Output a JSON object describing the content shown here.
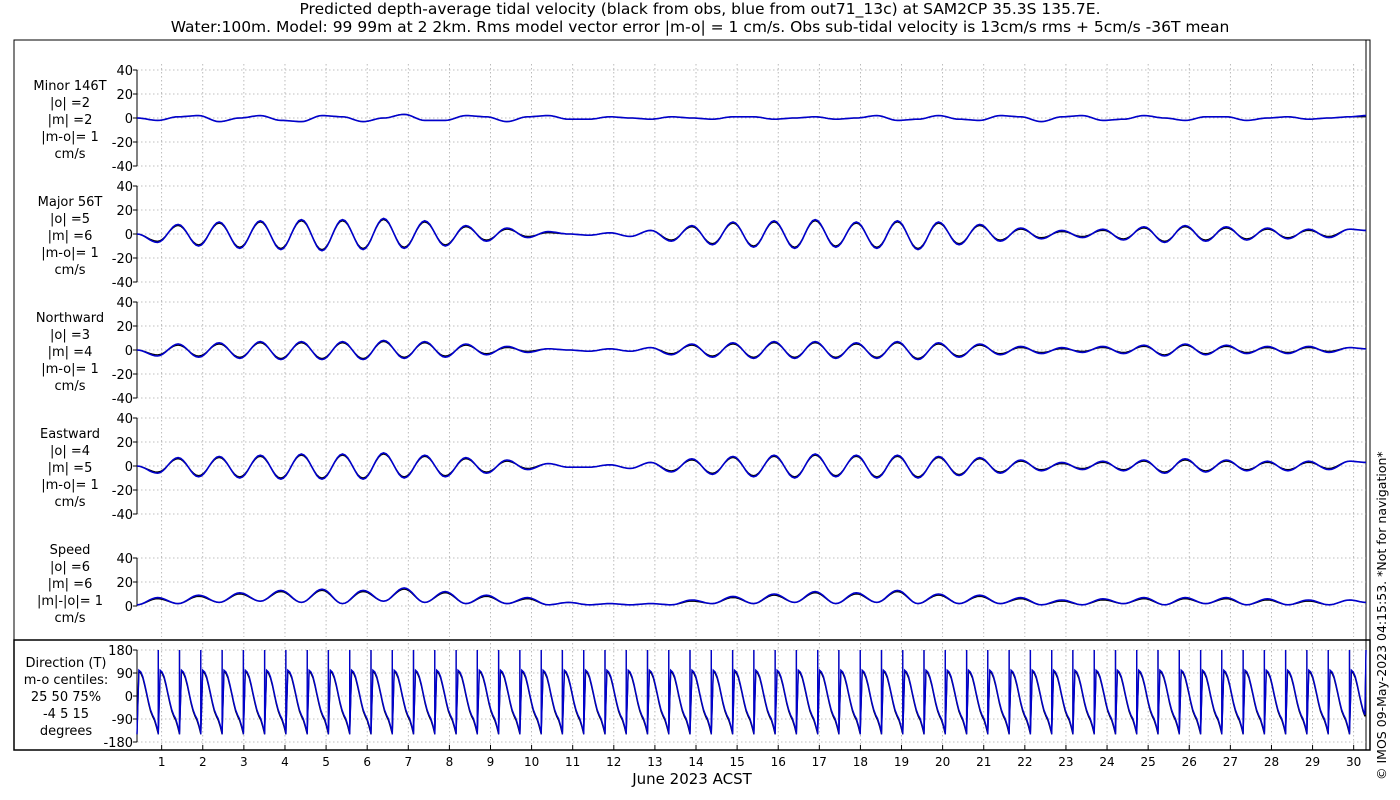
{
  "title_line1": "Predicted depth-average tidal velocity (black from obs, blue from out71_13c) at SAM2CP 35.3S 135.7E.",
  "title_line2": "Water:100m. Model: 99 99m at 2 2km. Rms model vector error |m-o| = 1 cm/s. Obs sub-tidal velocity is 13cm/s rms + 5cm/s -36T mean",
  "copyright": "© IMOS 09-May-2023 04:15:53.  *Not for navigation*",
  "colors": {
    "obs": "#000000",
    "model": "#0000cc",
    "grid": "#aaaaaa"
  },
  "chart_data": {
    "type": "line",
    "xlabel": "June 2023 ACST",
    "xlim": [
      0.4,
      30.3
    ],
    "x_ticks": [
      1,
      2,
      3,
      4,
      5,
      6,
      7,
      8,
      9,
      10,
      11,
      12,
      13,
      14,
      15,
      16,
      17,
      18,
      19,
      20,
      21,
      22,
      23,
      24,
      25,
      26,
      27,
      28,
      29,
      30
    ],
    "series_legend": [
      {
        "name": "obs",
        "color": "#000000"
      },
      {
        "name": "out71_13c",
        "color": "#0000cc"
      }
    ],
    "panels": [
      {
        "key": "minor",
        "label_lines": [
          "Minor 146T",
          "|o| =2",
          "|m| =2",
          "|m-o|= 1",
          "cm/s"
        ],
        "ylim": [
          -40,
          40
        ],
        "yticks": [
          "40",
          "20",
          "0",
          "-20",
          "-40"
        ],
        "x": [
          0.4,
          0.9,
          1.4,
          1.9,
          2.4,
          2.9,
          3.4,
          3.9,
          4.4,
          4.9,
          5.4,
          5.9,
          6.4,
          6.9,
          7.4,
          7.9,
          8.4,
          8.9,
          9.4,
          9.9,
          10.4,
          10.9,
          11.4,
          11.9,
          12.4,
          12.9,
          13.4,
          13.9,
          14.4,
          14.9,
          15.4,
          15.9,
          16.4,
          16.9,
          17.4,
          17.9,
          18.4,
          18.9,
          19.4,
          19.9,
          20.4,
          20.9,
          21.4,
          21.9,
          22.4,
          22.9,
          23.4,
          23.9,
          24.4,
          24.9,
          25.4,
          25.9,
          26.4,
          26.9,
          27.4,
          27.9,
          28.4,
          28.9,
          29.4,
          29.9,
          30.3
        ],
        "obs": [
          0,
          -2,
          1,
          2,
          -3,
          0,
          2,
          -2,
          -3,
          2,
          1,
          -3,
          0,
          3,
          -2,
          -2,
          2,
          1,
          -3,
          1,
          2,
          -1,
          -1,
          1,
          0,
          -1,
          1,
          0,
          -1,
          1,
          1,
          -1,
          0,
          1,
          -1,
          0,
          2,
          -2,
          -1,
          2,
          -1,
          -2,
          2,
          1,
          -3,
          1,
          2,
          -2,
          -1,
          2,
          0,
          -2,
          1,
          1,
          -2,
          0,
          1,
          -1,
          0,
          1,
          1
        ],
        "model": [
          0,
          -2,
          1,
          2,
          -3,
          0,
          2,
          -2,
          -3,
          2,
          1,
          -3,
          0,
          3,
          -2,
          -2,
          2,
          1,
          -3,
          1,
          2,
          -1,
          -1,
          1,
          0,
          -1,
          1,
          0,
          -1,
          1,
          1,
          -1,
          0,
          1,
          -1,
          0,
          2,
          -2,
          -1,
          2,
          -1,
          -2,
          2,
          1,
          -3,
          1,
          2,
          -2,
          -1,
          2,
          0,
          -2,
          1,
          1,
          -2,
          0,
          1,
          -1,
          0,
          1,
          2
        ]
      },
      {
        "key": "major",
        "label_lines": [
          "Major 56T",
          "|o| =5",
          "|m| =6",
          "|m-o|= 1",
          "cm/s"
        ],
        "ylim": [
          -40,
          40
        ],
        "yticks": [
          "40",
          "20",
          "0",
          "-20",
          "-40"
        ],
        "x": [
          0.4,
          0.9,
          1.4,
          1.9,
          2.4,
          2.9,
          3.4,
          3.9,
          4.4,
          4.9,
          5.4,
          5.9,
          6.4,
          6.9,
          7.4,
          7.9,
          8.4,
          8.9,
          9.4,
          9.9,
          10.4,
          10.9,
          11.4,
          11.9,
          12.4,
          12.9,
          13.4,
          13.9,
          14.4,
          14.9,
          15.4,
          15.9,
          16.4,
          16.9,
          17.4,
          17.9,
          18.4,
          18.9,
          19.4,
          19.9,
          20.4,
          20.9,
          21.4,
          21.9,
          22.4,
          22.9,
          23.4,
          23.9,
          24.4,
          24.9,
          25.4,
          25.9,
          26.4,
          26.9,
          27.4,
          27.9,
          28.4,
          28.9,
          29.4,
          29.9,
          30.3
        ],
        "obs": [
          0,
          -6,
          7,
          -9,
          9,
          -11,
          10,
          -12,
          11,
          -13,
          11,
          -12,
          12,
          -11,
          10,
          -9,
          6,
          -5,
          4,
          -2,
          1,
          0,
          -1,
          1,
          -2,
          3,
          -5,
          6,
          -8,
          9,
          -10,
          10,
          -11,
          11,
          -10,
          9,
          -11,
          10,
          -12,
          9,
          -8,
          7,
          -5,
          4,
          -3,
          2,
          -2,
          3,
          -4,
          5,
          -6,
          6,
          -5,
          5,
          -4,
          4,
          -3,
          3,
          -2,
          4,
          3
        ],
        "model": [
          0,
          -7,
          8,
          -10,
          10,
          -12,
          11,
          -13,
          12,
          -14,
          12,
          -13,
          13,
          -12,
          11,
          -10,
          7,
          -6,
          5,
          -3,
          2,
          0,
          -1,
          1,
          -2,
          3,
          -6,
          7,
          -9,
          10,
          -11,
          11,
          -12,
          12,
          -11,
          10,
          -12,
          11,
          -13,
          10,
          -9,
          8,
          -6,
          5,
          -4,
          3,
          -3,
          4,
          -5,
          6,
          -7,
          7,
          -6,
          6,
          -5,
          5,
          -4,
          4,
          -3,
          4,
          3
        ]
      },
      {
        "key": "north",
        "label_lines": [
          "Northward",
          "|o| =3",
          "|m| =4",
          "|m-o|= 1",
          "cm/s"
        ],
        "ylim": [
          -40,
          40
        ],
        "yticks": [
          "40",
          "20",
          "0",
          "-20",
          "-40"
        ],
        "x": [
          0.4,
          0.9,
          1.4,
          1.9,
          2.4,
          2.9,
          3.4,
          3.9,
          4.4,
          4.9,
          5.4,
          5.9,
          6.4,
          6.9,
          7.4,
          7.9,
          8.4,
          8.9,
          9.4,
          9.9,
          10.4,
          10.9,
          11.4,
          11.9,
          12.4,
          12.9,
          13.4,
          13.9,
          14.4,
          14.9,
          15.4,
          15.9,
          16.4,
          16.9,
          17.4,
          17.9,
          18.4,
          18.9,
          19.4,
          19.9,
          20.4,
          20.9,
          21.4,
          21.9,
          22.4,
          22.9,
          23.4,
          23.9,
          24.4,
          24.9,
          25.4,
          25.9,
          26.4,
          26.9,
          27.4,
          27.9,
          28.4,
          28.9,
          29.4,
          29.9,
          30.3
        ],
        "obs": [
          0,
          -4,
          4,
          -5,
          5,
          -6,
          6,
          -7,
          6,
          -7,
          6,
          -7,
          7,
          -6,
          6,
          -5,
          4,
          -3,
          2,
          -1,
          1,
          0,
          -1,
          1,
          -1,
          2,
          -3,
          4,
          -5,
          5,
          -6,
          6,
          -6,
          6,
          -6,
          5,
          -6,
          6,
          -7,
          5,
          -5,
          4,
          -3,
          2,
          -2,
          1,
          -1,
          2,
          -2,
          3,
          -4,
          4,
          -3,
          3,
          -2,
          2,
          -2,
          2,
          -1,
          2,
          1
        ],
        "model": [
          0,
          -5,
          5,
          -6,
          6,
          -7,
          7,
          -8,
          7,
          -8,
          7,
          -8,
          8,
          -7,
          7,
          -6,
          5,
          -4,
          3,
          -2,
          1,
          0,
          -1,
          1,
          -1,
          2,
          -4,
          5,
          -6,
          6,
          -7,
          7,
          -7,
          7,
          -7,
          6,
          -7,
          7,
          -8,
          6,
          -6,
          5,
          -4,
          3,
          -3,
          2,
          -2,
          3,
          -3,
          4,
          -5,
          5,
          -4,
          4,
          -3,
          3,
          -3,
          3,
          -2,
          2,
          1
        ]
      },
      {
        "key": "east",
        "label_lines": [
          "Eastward",
          "|o| =4",
          "|m| =5",
          "|m-o|= 1",
          "cm/s"
        ],
        "ylim": [
          -40,
          40
        ],
        "yticks": [
          "40",
          "20",
          "0",
          "-20",
          "-40"
        ],
        "x": [
          0.4,
          0.9,
          1.4,
          1.9,
          2.4,
          2.9,
          3.4,
          3.9,
          4.4,
          4.9,
          5.4,
          5.9,
          6.4,
          6.9,
          7.4,
          7.9,
          8.4,
          8.9,
          9.4,
          9.9,
          10.4,
          10.9,
          11.4,
          11.9,
          12.4,
          12.9,
          13.4,
          13.9,
          14.4,
          14.9,
          15.4,
          15.9,
          16.4,
          16.9,
          17.4,
          17.9,
          18.4,
          18.9,
          19.4,
          19.9,
          20.4,
          20.9,
          21.4,
          21.9,
          22.4,
          22.9,
          23.4,
          23.9,
          24.4,
          24.9,
          25.4,
          25.9,
          26.4,
          26.9,
          27.4,
          27.9,
          28.4,
          28.9,
          29.4,
          29.9,
          30.3
        ],
        "obs": [
          0,
          -5,
          6,
          -8,
          7,
          -9,
          8,
          -10,
          9,
          -10,
          9,
          -10,
          10,
          -9,
          8,
          -8,
          6,
          -5,
          4,
          -2,
          2,
          -1,
          -1,
          1,
          -2,
          3,
          -4,
          5,
          -6,
          7,
          -8,
          8,
          -9,
          9,
          -8,
          8,
          -9,
          8,
          -9,
          7,
          -7,
          6,
          -5,
          4,
          -3,
          2,
          -2,
          3,
          -3,
          4,
          -5,
          5,
          -4,
          4,
          -3,
          3,
          -3,
          3,
          -2,
          4,
          3
        ],
        "model": [
          0,
          -6,
          7,
          -9,
          8,
          -10,
          9,
          -11,
          10,
          -11,
          10,
          -11,
          11,
          -10,
          9,
          -9,
          7,
          -6,
          5,
          -3,
          2,
          -1,
          -1,
          1,
          -2,
          3,
          -5,
          6,
          -7,
          8,
          -9,
          9,
          -10,
          10,
          -9,
          9,
          -10,
          9,
          -10,
          8,
          -8,
          7,
          -6,
          5,
          -4,
          3,
          -3,
          4,
          -4,
          5,
          -6,
          6,
          -5,
          5,
          -4,
          4,
          -4,
          4,
          -3,
          4,
          3
        ]
      },
      {
        "key": "speed",
        "label_lines": [
          "Speed",
          "|o| =6",
          "|m| =6",
          "|m|-|o|= 1",
          "cm/s"
        ],
        "ylim": [
          0,
          40
        ],
        "yticks": [
          "40",
          "20",
          "0"
        ],
        "x": [
          0.4,
          0.9,
          1.4,
          1.9,
          2.4,
          2.9,
          3.4,
          3.9,
          4.4,
          4.9,
          5.4,
          5.9,
          6.4,
          6.9,
          7.4,
          7.9,
          8.4,
          8.9,
          9.4,
          9.9,
          10.4,
          10.9,
          11.4,
          11.9,
          12.4,
          12.9,
          13.4,
          13.9,
          14.4,
          14.9,
          15.4,
          15.9,
          16.4,
          16.9,
          17.4,
          17.9,
          18.4,
          18.9,
          19.4,
          19.9,
          20.4,
          20.9,
          21.4,
          21.9,
          22.4,
          22.9,
          23.4,
          23.9,
          24.4,
          24.9,
          25.4,
          25.9,
          26.4,
          26.9,
          27.4,
          27.9,
          28.4,
          28.9,
          29.4,
          29.9,
          30.3
        ],
        "obs": [
          1,
          6,
          2,
          8,
          3,
          10,
          4,
          12,
          3,
          13,
          2,
          12,
          4,
          14,
          3,
          11,
          2,
          8,
          2,
          6,
          1,
          3,
          1,
          2,
          1,
          2,
          1,
          4,
          2,
          7,
          2,
          9,
          3,
          11,
          2,
          10,
          3,
          12,
          2,
          9,
          2,
          8,
          2,
          6,
          1,
          4,
          1,
          5,
          2,
          6,
          1,
          6,
          2,
          6,
          1,
          5,
          1,
          4,
          1,
          5,
          3
        ],
        "model": [
          1,
          7,
          2,
          9,
          3,
          11,
          4,
          13,
          3,
          14,
          2,
          13,
          4,
          15,
          3,
          12,
          2,
          9,
          2,
          7,
          1,
          3,
          1,
          2,
          1,
          2,
          1,
          5,
          2,
          8,
          2,
          10,
          3,
          12,
          2,
          11,
          3,
          13,
          2,
          10,
          2,
          9,
          2,
          7,
          1,
          5,
          1,
          6,
          2,
          7,
          1,
          7,
          2,
          7,
          1,
          6,
          1,
          5,
          1,
          5,
          3
        ]
      }
    ],
    "direction_panel": {
      "label_lines": [
        "Direction (T)",
        "m-o centiles:",
        "25  50  75%",
        "-4   5  15",
        "degrees"
      ],
      "ylim": [
        -180,
        180
      ],
      "yticks": [
        "180",
        "90",
        "0",
        "-90",
        "-180"
      ],
      "cycle_period_days": 0.5175,
      "cycle_start_day": 0.4,
      "cycle_profile_deg": [
        -150,
        95,
        88,
        70,
        40,
        5,
        -30,
        -60,
        -80,
        -95,
        -120,
        -150
      ],
      "model_offset_deg": 6
    }
  }
}
